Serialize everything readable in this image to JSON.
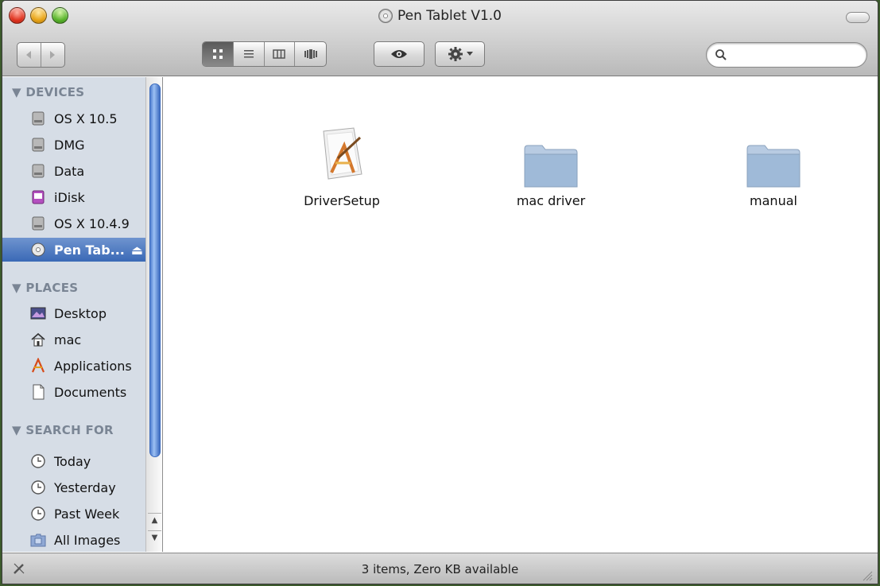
{
  "window": {
    "title": "Pen Tablet V1.0"
  },
  "toolbar": {
    "search": {
      "value": "",
      "placeholder": ""
    },
    "view_modes": [
      "icon-view",
      "list-view",
      "column-view",
      "cover-flow-view"
    ],
    "active_view": "icon-view"
  },
  "sidebar": {
    "devices_header": "▼ DEVICES",
    "devices": [
      {
        "label": "OS X 10.5",
        "icon": "hard-drive-icon"
      },
      {
        "label": "DMG",
        "icon": "hard-drive-icon"
      },
      {
        "label": "Data",
        "icon": "hard-drive-icon"
      },
      {
        "label": "iDisk",
        "icon": "idisk-icon"
      },
      {
        "label": "OS X 10.4.9",
        "icon": "hard-drive-icon"
      },
      {
        "label": "Pen Tab...",
        "icon": "disc-icon",
        "selected": true,
        "eject": "⏏"
      }
    ],
    "places_header": "▼ PLACES",
    "places": [
      {
        "label": "Desktop",
        "icon": "desktop-icon"
      },
      {
        "label": "mac",
        "icon": "home-icon"
      },
      {
        "label": "Applications",
        "icon": "applications-icon"
      },
      {
        "label": "Documents",
        "icon": "documents-icon"
      }
    ],
    "search_header": "▼ SEARCH FOR",
    "searches": [
      {
        "label": "Today",
        "icon": "clock-icon"
      },
      {
        "label": "Yesterday",
        "icon": "clock-icon"
      },
      {
        "label": "Past Week",
        "icon": "clock-icon"
      },
      {
        "label": "All Images",
        "icon": "images-folder-icon"
      }
    ]
  },
  "files": [
    {
      "name": "DriverSetup",
      "icon": "installer-app-icon"
    },
    {
      "name": "mac driver",
      "icon": "folder-icon"
    },
    {
      "name": "manual",
      "icon": "folder-icon"
    }
  ],
  "status": {
    "text": "3 items, Zero KB available"
  },
  "colors": {
    "selection": "#3a69b6",
    "sidebar_bg": "#d6dde6",
    "folder": "#9fbad8"
  }
}
